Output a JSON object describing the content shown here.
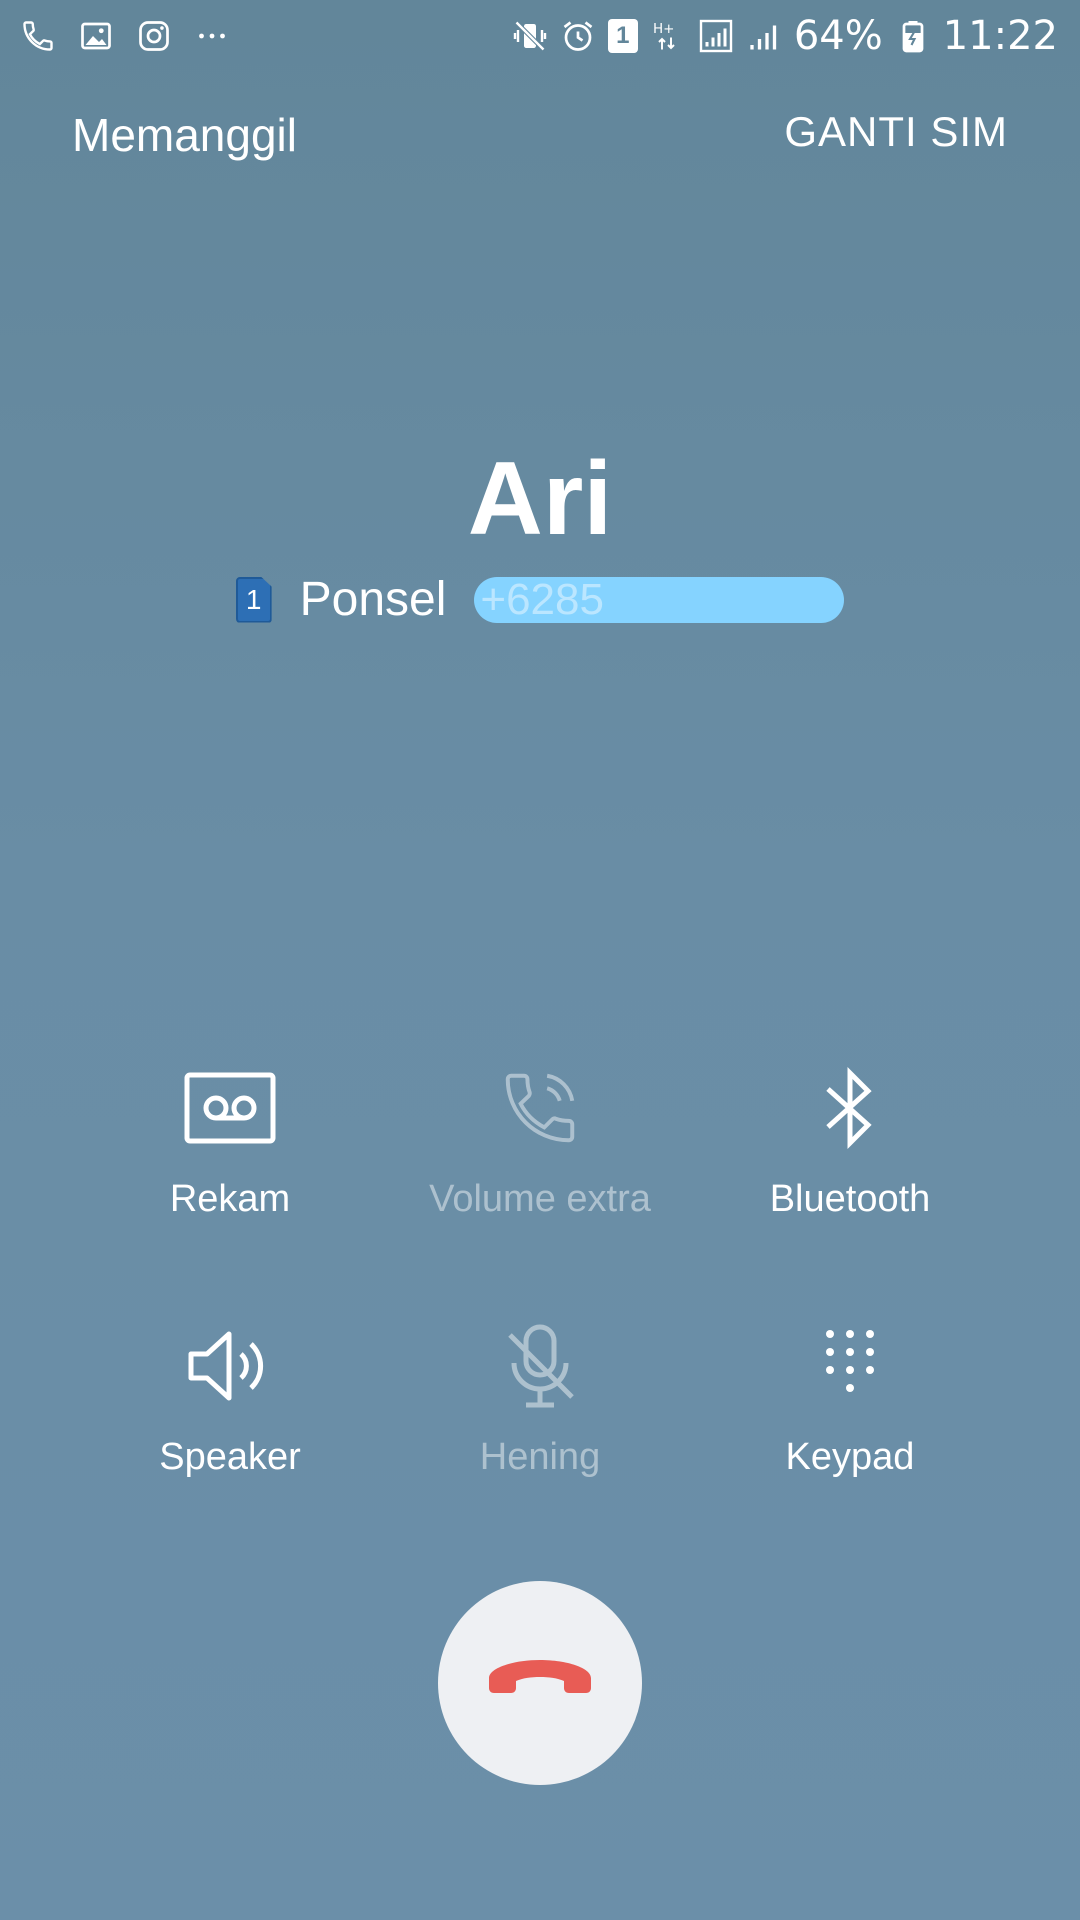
{
  "status_bar": {
    "battery": "64%",
    "time": "11:22",
    "sim_slot": "1",
    "network": "H+",
    "left_icons": [
      "phone-icon",
      "image-icon",
      "instagram-icon",
      "more-icon"
    ],
    "right_icons": [
      "vibrate-icon",
      "alarm-icon",
      "sim-icon",
      "data-icon",
      "signal-icon",
      "signal-icon",
      "battery-icon"
    ]
  },
  "header": {
    "status": "Memanggil",
    "switch_sim": "GANTI SIM"
  },
  "caller": {
    "name": "Ari",
    "sim_slot": "1",
    "type": "Ponsel",
    "number_visible_fragment": "+6285"
  },
  "controls": [
    {
      "label": "Rekam",
      "icon": "record-icon",
      "enabled": true
    },
    {
      "label": "Volume extra",
      "icon": "extra-volume-icon",
      "enabled": false
    },
    {
      "label": "Bluetooth",
      "icon": "bluetooth-icon",
      "enabled": true
    },
    {
      "label": "Speaker",
      "icon": "speaker-icon",
      "enabled": true
    },
    {
      "label": "Hening",
      "icon": "mute-icon",
      "enabled": false
    },
    {
      "label": "Keypad",
      "icon": "keypad-icon",
      "enabled": true
    }
  ],
  "end_call": {
    "icon": "end-call-icon",
    "color": "#e85c55"
  },
  "colors": {
    "background": "#6a8ea6",
    "end_button_bg": "#eef0f3",
    "redaction": "#85d3ff"
  }
}
